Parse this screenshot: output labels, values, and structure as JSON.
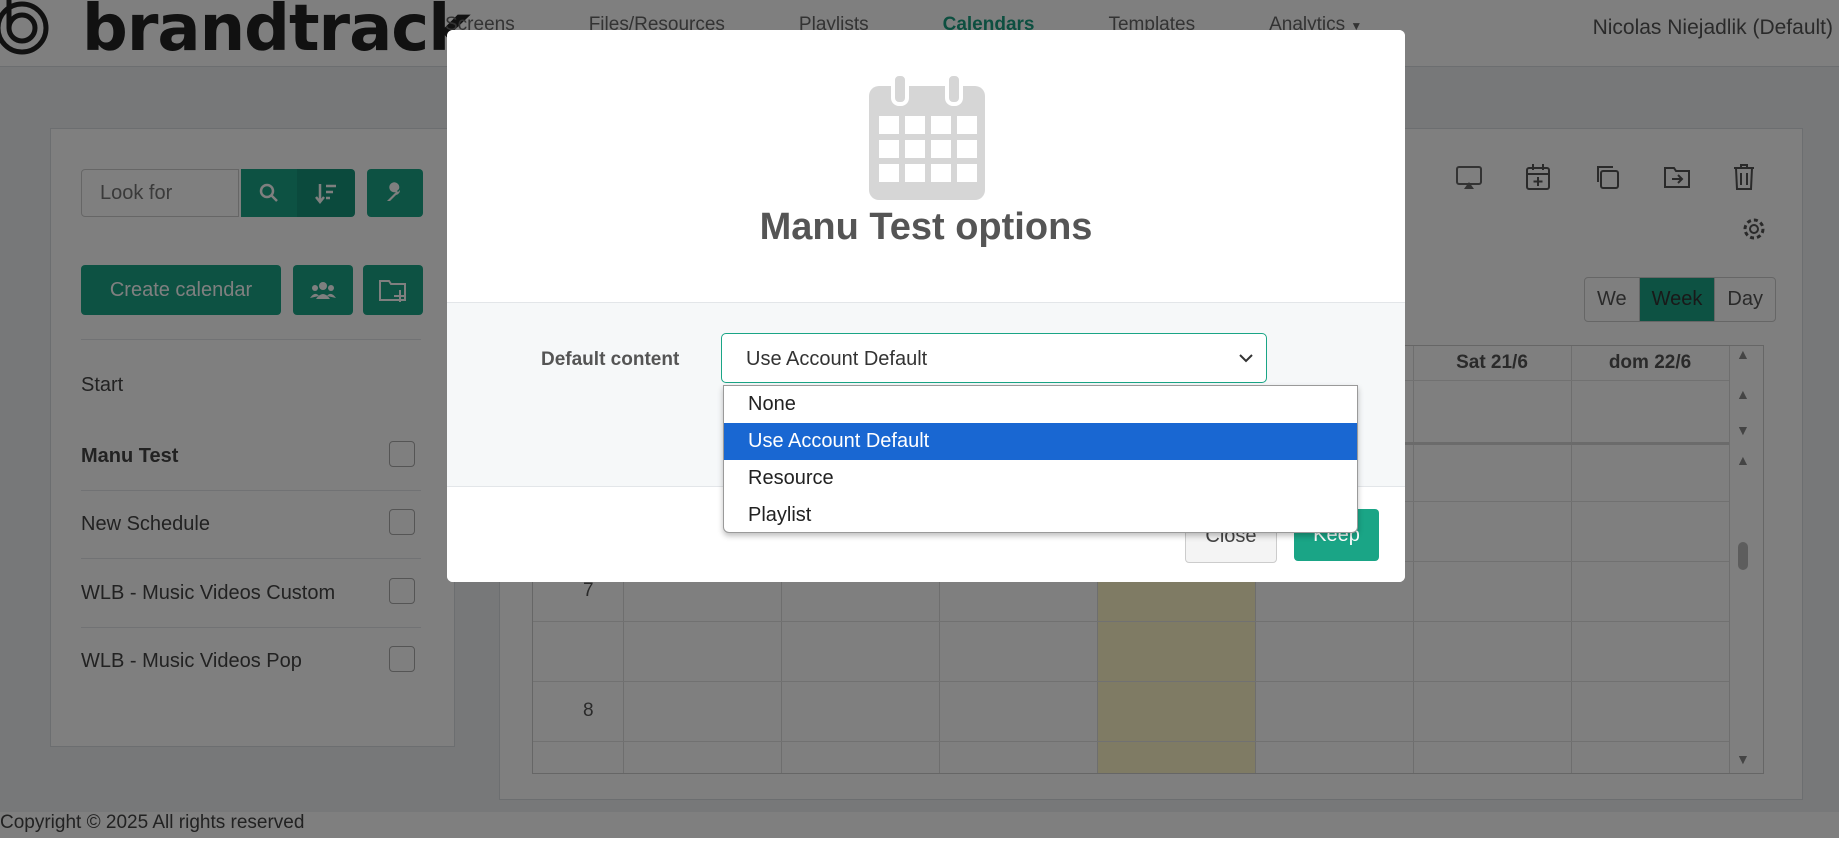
{
  "header": {
    "brand": "brandtrack",
    "nav": [
      {
        "label": "Screens",
        "active": false
      },
      {
        "label": "Files/Resources",
        "active": false
      },
      {
        "label": "Playlists",
        "active": false
      },
      {
        "label": "Calendars",
        "active": true
      },
      {
        "label": "Templates",
        "active": false
      },
      {
        "label": "Analytics",
        "active": false
      }
    ],
    "user": "Nicolas Niejadlik (Default)"
  },
  "sidebar": {
    "search_placeholder": "Look for",
    "create_label": "Create calendar",
    "start_label": "Start",
    "items": [
      {
        "label": "Manu Test",
        "bold": true
      },
      {
        "label": "New Schedule",
        "bold": false
      },
      {
        "label": "WLB - Music Videos Custom",
        "bold": false
      },
      {
        "label": "WLB - Music Videos Pop",
        "bold": false
      }
    ]
  },
  "calendar": {
    "view_buttons": [
      {
        "label": "We",
        "active": false
      },
      {
        "label": "Week",
        "active": true
      },
      {
        "label": "Day",
        "active": false
      }
    ],
    "day_headers": [
      "Sat 21/6",
      "dom 22/6"
    ],
    "hours": [
      "7",
      "8"
    ]
  },
  "footer": {
    "text": "Copyright © 2025 All rights reserved"
  },
  "modal": {
    "title": "Manu Test options",
    "field_label": "Default content",
    "selected_value": "Use Account Default",
    "options": [
      {
        "label": "None",
        "selected": false
      },
      {
        "label": "Use Account Default",
        "selected": true
      },
      {
        "label": "Resource",
        "selected": false
      },
      {
        "label": "Playlist",
        "selected": false
      }
    ],
    "close_label": "Close",
    "keep_label": "Keep"
  },
  "colors": {
    "accent": "#1aa586",
    "select_highlight": "#1967d2",
    "today": "#fff6c8"
  }
}
